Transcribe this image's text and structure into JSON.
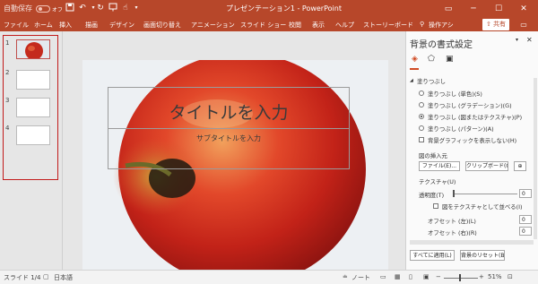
{
  "titlebar": {
    "autosave_label": "自動保存",
    "autosave_state": "オフ",
    "document_title": "プレゼンテーション1 - PowerPoint",
    "colors": {
      "accent": "#b7472a"
    }
  },
  "ribbon": {
    "tabs": [
      "ファイル",
      "ホーム",
      "挿入",
      "描画",
      "デザイン",
      "画面切り替え",
      "アニメーション",
      "スライド ショー",
      "校閲",
      "表示",
      "ヘルプ",
      "ストーリーボード"
    ],
    "search_label": "操作アシ",
    "share_label": "共有"
  },
  "thumbnails": {
    "numbers": [
      "1",
      "2",
      "3",
      "4"
    ]
  },
  "slide": {
    "title": "タイトルを入力",
    "subtitle": "サブタイトルを入力"
  },
  "format_pane": {
    "title": "背景の書式設定",
    "section": "塗りつぶし",
    "fill_options": [
      "塗りつぶし (単色)(S)",
      "塗りつぶし (グラデーション)(G)",
      "塗りつぶし (図またはテクスチャ)(P)",
      "塗りつぶし (パターン)(A)"
    ],
    "hide_graphics": "背景グラフィックを表示しない(H)",
    "insert_source": "図の挿入元",
    "file_button": "ファイル(E)...",
    "clipboard_button": "クリップボード(C)",
    "texture_label": "テクスチャ(U)",
    "transparency_label": "透明度(T)",
    "transparency_value": "0",
    "tile_label": "図をテクスチャとして並べる(I)",
    "offset_left_label": "オフセット (左)(L)",
    "offset_left_value": "0",
    "offset_right_label": "オフセット (右)(R)",
    "offset_right_value": "0",
    "apply_all_button": "すべてに適用(L)",
    "reset_button": "背景のリセット(B)"
  },
  "statusbar": {
    "slide_info": "スライド 1/4",
    "language": "日本語",
    "notes_label": "ノート",
    "zoom": "51%"
  }
}
